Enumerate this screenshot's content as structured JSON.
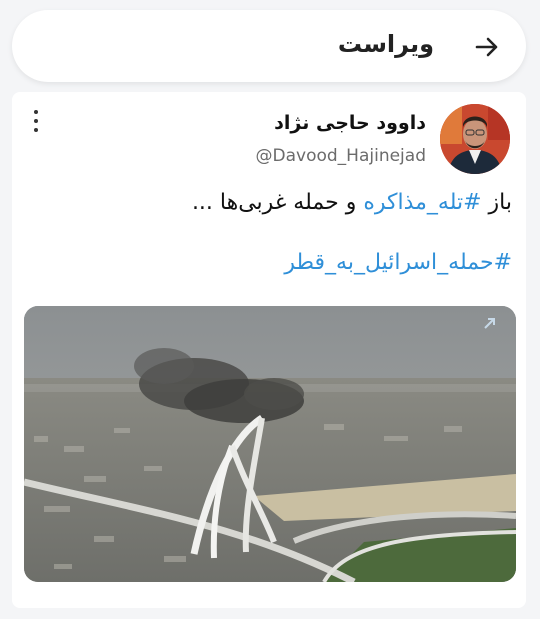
{
  "header": {
    "title": "ویراست",
    "back_icon": "arrow-right-icon"
  },
  "post": {
    "display_name": "داوود حاجی نژاد",
    "handle": "@Davood_Hajinejad",
    "more_icon": "more-vertical-icon",
    "text_prefix": "باز ",
    "hashtag1": "#تله_مذاکره",
    "text_suffix": " و حمله غربی‌ها ...",
    "hashtag2": "#حمله_اسرائیل_به_قطر",
    "media_icon": "external-link-icon"
  },
  "colors": {
    "accent": "#2f8fd8",
    "background": "#f4f5f7",
    "card": "#ffffff"
  }
}
